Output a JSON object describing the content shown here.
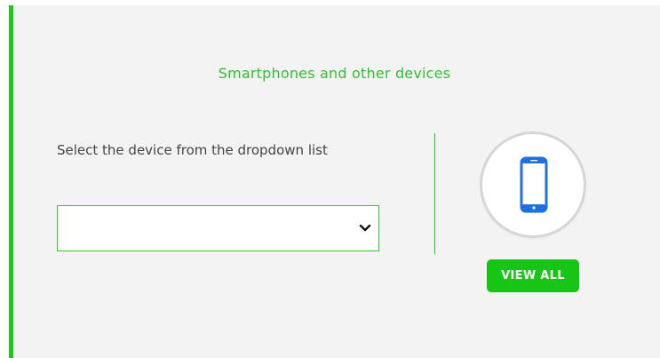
{
  "section": {
    "heading": "Smartphones and other devices",
    "instructions": "Select the device from the dropdown list"
  },
  "device_select": {
    "selected_value": ""
  },
  "icons": {
    "dropdown": "chevron-down-icon",
    "device": "smartphone-icon"
  },
  "actions": {
    "view_all_label": "VIEW ALL"
  },
  "colors": {
    "accent": "#1ec81e",
    "heading_text": "#2fbf2f",
    "button_bg": "#16c516",
    "panel_bg": "#f3f3f3",
    "phone_blue": "#1f6fe0"
  }
}
